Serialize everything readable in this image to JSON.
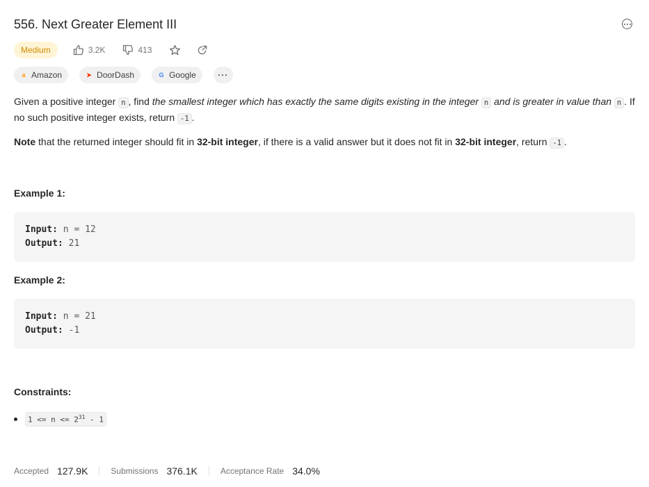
{
  "problem": {
    "title": "556. Next Greater Element III",
    "difficulty": "Medium",
    "likes": "3.2K",
    "dislikes": "413"
  },
  "tags": [
    {
      "label": "Amazon",
      "icon": "amazon-logo"
    },
    {
      "label": "DoorDash",
      "icon": "doordash-logo"
    },
    {
      "label": "Google",
      "icon": "google-logo"
    },
    {
      "label": "···",
      "icon": "more-icon"
    }
  ],
  "description": {
    "p1_a": "Given a positive integer ",
    "p1_code1": "n",
    "p1_b": ", find ",
    "p1_em1": "the smallest integer which has exactly the same digits existing in the integer ",
    "p1_code2": "n",
    "p1_em2": " and is greater in value than ",
    "p1_code3": "n",
    "p1_c": ". If no such positive integer exists, return ",
    "p1_code4": "-1",
    "p1_d": ".",
    "p2_a": "Note",
    "p2_b": " that the returned integer should fit in ",
    "p2_c": "32-bit integer",
    "p2_d": ", if there is a valid answer but it does not fit in ",
    "p2_e": "32-bit integer",
    "p2_f": ", return ",
    "p2_code": "-1",
    "p2_g": "."
  },
  "examples": [
    {
      "heading": "Example 1:",
      "input_label": "Input:",
      "input": "n = 12",
      "output_label": "Output:",
      "output": "21"
    },
    {
      "heading": "Example 2:",
      "input_label": "Input:",
      "input": "n = 21",
      "output_label": "Output:",
      "output": "-1"
    }
  ],
  "constraints": {
    "heading": "Constraints:",
    "item_a": "1 <= n <= 2",
    "item_sup": "31",
    "item_b": " - 1"
  },
  "stats": {
    "accepted_label": "Accepted",
    "accepted": "127.9K",
    "submissions_label": "Submissions",
    "submissions": "376.1K",
    "rate_label": "Acceptance Rate",
    "rate": "34.0%"
  },
  "colors": {
    "difficulty_bg": "#fff4d6",
    "difficulty_text": "#d08c00",
    "example_bg": "#f5f5f5"
  }
}
